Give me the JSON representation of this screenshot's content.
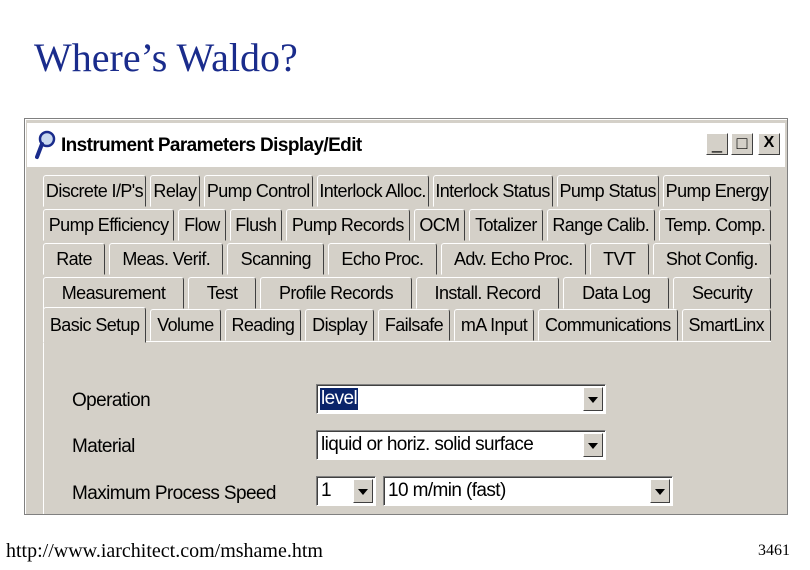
{
  "slide": {
    "title": "Where’s Waldo?",
    "footer_url": "http://www.iarchitect.com/mshame.htm",
    "slide_number": "3461"
  },
  "window": {
    "title": "Instrument Parameters Display/Edit",
    "controls": {
      "minimize": "_",
      "maximize": "□",
      "close": "X"
    }
  },
  "tab_rows": [
    [
      "Discrete I/P's",
      "Relay",
      "Pump Control",
      "Interlock Alloc.",
      "Interlock Status",
      "Pump Status",
      "Pump Energy"
    ],
    [
      "Pump Efficiency",
      "Flow",
      "Flush",
      "Pump Records",
      "OCM",
      "Totalizer",
      "Range Calib.",
      "Temp. Comp."
    ],
    [
      "Rate",
      "Meas. Verif.",
      "Scanning",
      "Echo Proc.",
      "Adv. Echo Proc.",
      "TVT",
      "Shot Config."
    ],
    [
      "Measurement",
      "Test",
      "Profile Records",
      "Install. Record",
      "Data Log",
      "Security"
    ],
    [
      "Basic Setup",
      "Volume",
      "Reading",
      "Display",
      "Failsafe",
      "mA Input",
      "Communications",
      "SmartLinx"
    ]
  ],
  "active_tab": "Basic Setup",
  "form": {
    "operation": {
      "label": "Operation",
      "value": "level"
    },
    "material": {
      "label": "Material",
      "value": "liquid or horiz. solid surface"
    },
    "max_speed": {
      "label": "Maximum Process Speed",
      "point_value": "1",
      "value": "10 m/min (fast)"
    }
  },
  "colors": {
    "title": "#1a2c8c",
    "window_face": "#d4d0c8",
    "selection": "#0a246a"
  }
}
